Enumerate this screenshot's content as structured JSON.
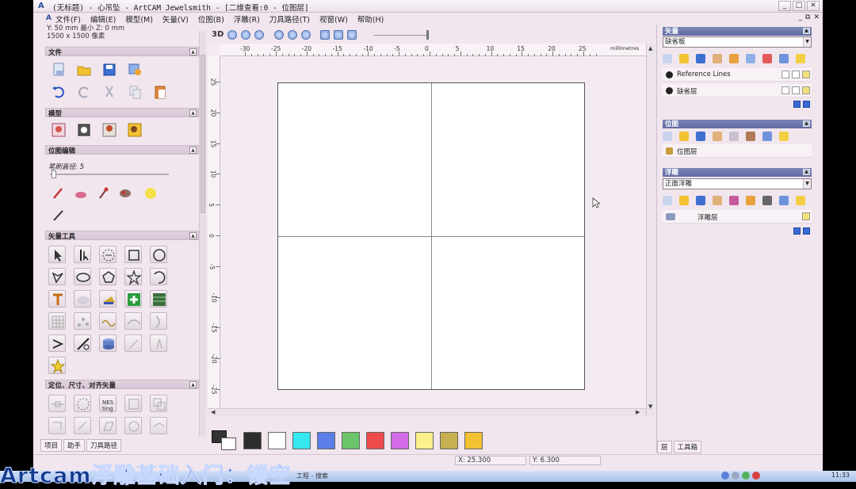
{
  "window": {
    "title": "(无标题) - 心吊坠 - ArtCAM Jewelsmith - [二维查看:0 - 位图层]"
  },
  "menu": [
    "文件(F)",
    "编辑(E)",
    "模型(M)",
    "矢量(V)",
    "位图(B)",
    "浮雕(R)",
    "刀具路径(T)",
    "视窗(W)",
    "帮助(H)"
  ],
  "left_panel": {
    "info_lines": [
      "Y: 50 mm        最小 Z: 0 mm",
      "1500 x 1500 像素"
    ],
    "sections": {
      "file": "文件",
      "model": "模型",
      "bitmap_edit": "位图编辑",
      "vector_tools": "矢量工具",
      "align": "定位、尺寸、对齐矢量"
    },
    "brush_label": "笔刷直径:",
    "brush_value": "5",
    "tabs": [
      "项目",
      "助手",
      "刀具路径"
    ]
  },
  "view_toolbar": {
    "mode_label": "3D"
  },
  "ruler": {
    "unit": "millimetres",
    "top_labels": [
      "-30",
      "-25",
      "-20",
      "-15",
      "-10",
      "-5",
      "0",
      "5",
      "10",
      "15",
      "20",
      "25"
    ],
    "left_labels": [
      "25",
      "20",
      "15",
      "10",
      "5",
      "0",
      "-5",
      "-10",
      "-15",
      "-20",
      "-25"
    ]
  },
  "palette": {
    "colors": [
      "#2d2d2d",
      "#ffffff",
      "#35e8f0",
      "#5a7fe8",
      "#6cc46a",
      "#ee4b4b",
      "#d36be6",
      "#fbf08b",
      "#c6b04f",
      "#f3c232"
    ]
  },
  "status": {
    "x": "X: 25.300",
    "y": "Y: 6.300"
  },
  "right_panel": {
    "vector": {
      "header": "矢量",
      "combo": "缺省板",
      "layers": [
        "Reference Lines",
        "缺省层"
      ]
    },
    "bitmap": {
      "header": "位图",
      "layer": "位图层"
    },
    "relief": {
      "header": "浮雕",
      "combo": "正面浮雕",
      "layer": "浮雕层"
    },
    "tabs": [
      "层",
      "工具箱"
    ]
  },
  "taskbar": {
    "task": "工程 - 搜索",
    "time": "11:33"
  },
  "caption": "Artcam浮雕基础入门：镂空"
}
